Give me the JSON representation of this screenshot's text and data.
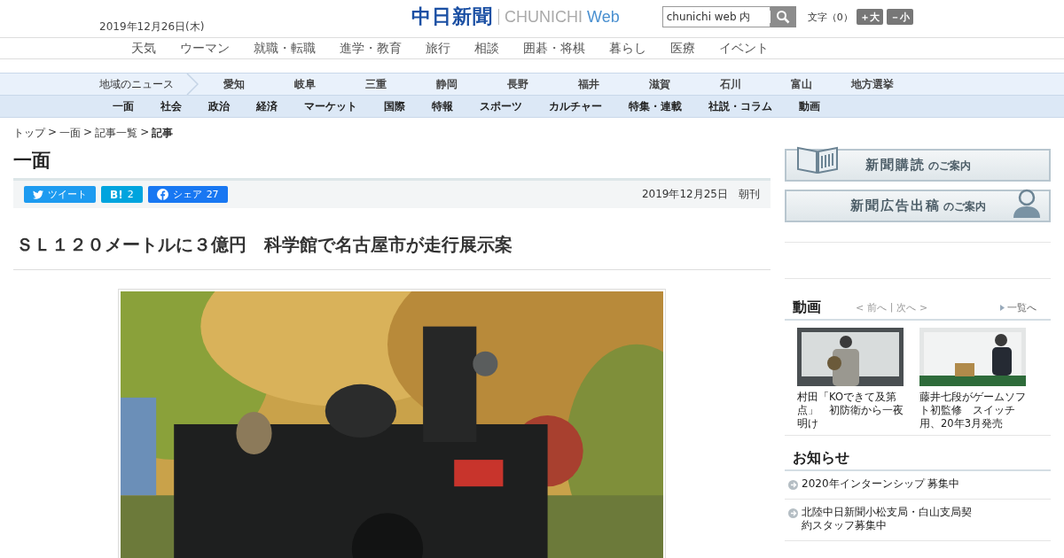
{
  "header": {
    "date": "2019年12月26日(木)",
    "logo_kanji": "中日新聞",
    "logo_latin": "CHUNICHI",
    "logo_web": "Web",
    "search": {
      "value": "chunichi web 内"
    },
    "font_size": {
      "label": "文字（0）",
      "buttons": [
        "＋大",
        "－小"
      ]
    }
  },
  "service_nav": [
    "天気",
    "ウーマン",
    "就職・転職",
    "進学・教育",
    "旅行",
    "相談",
    "囲碁・将棋",
    "暮らし",
    "医療",
    "イベント"
  ],
  "region_nav": {
    "label": "地域のニュース",
    "items": [
      "愛知",
      "岐阜",
      "三重",
      "静岡",
      "長野",
      "福井",
      "滋賀",
      "石川",
      "富山",
      "地方選挙"
    ]
  },
  "section_nav": [
    "一面",
    "社会",
    "政治",
    "経済",
    "マーケット",
    "国際",
    "特報",
    "スポーツ",
    "カルチャー",
    "特集・連載",
    "社説・コラム",
    "動画"
  ],
  "breadcrumb": {
    "separator": ">",
    "items": [
      "トップ",
      "一面",
      "記事一覧",
      "記事"
    ]
  },
  "section_title": "一面",
  "share": [
    {
      "kind": "twitter",
      "label": "ツイート"
    },
    {
      "kind": "hatena",
      "label": "B!",
      "count": "2"
    },
    {
      "kind": "facebook",
      "label": "シェア",
      "count": "27"
    }
  ],
  "article_date": "2019年12月25日　朝刊",
  "headline": "ＳＬ１２０メートルに３億円　科学館で名古屋市が走行展示案",
  "banners": [
    {
      "kind": "book",
      "text": "新聞購読",
      "suffix": "のご案内"
    },
    {
      "kind": "person",
      "text": "新聞広告出稿",
      "suffix": "のご案内"
    }
  ],
  "video": {
    "title": "動画",
    "prev": "< 前へ",
    "divider": "|",
    "next": "次へ >",
    "list": "一覧へ",
    "items": [
      {
        "caption": "村田「KOできて及第点」　初防衛から一夜明け"
      },
      {
        "caption": "藤井七段がゲームソフト初監修　スイッチ用、20年3月発売"
      }
    ]
  },
  "notices": {
    "title": "お知らせ",
    "items": [
      "2020年インターンシップ 募集中",
      "北陸中日新聞小松支局・白山支局契約スタッフ募集中"
    ]
  }
}
